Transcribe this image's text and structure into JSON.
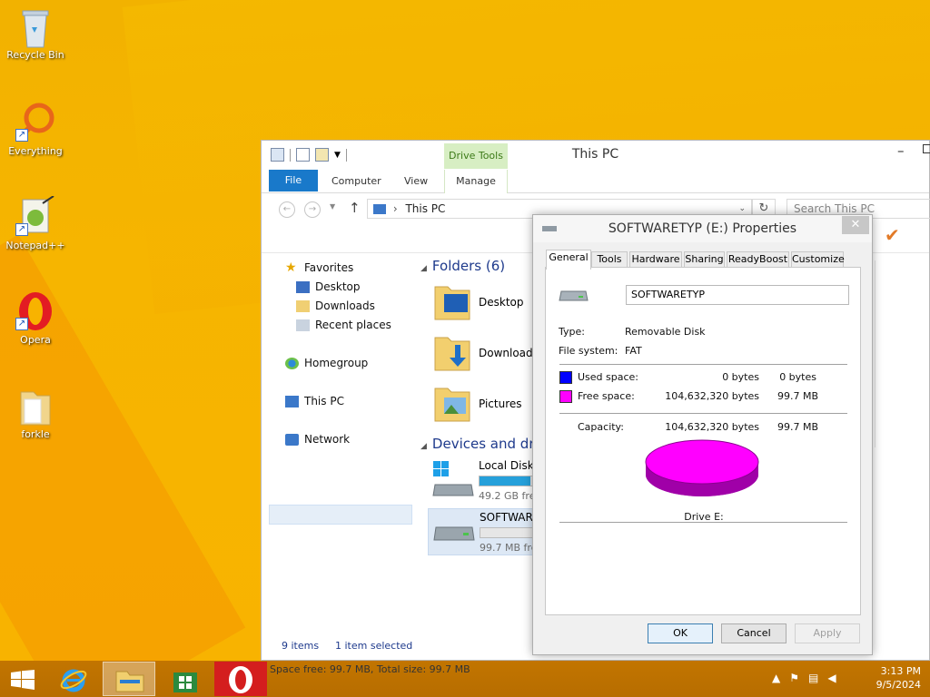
{
  "desktop": {
    "icons": [
      {
        "label": "Recycle Bin"
      },
      {
        "label": "Everything"
      },
      {
        "label": "Notepad++"
      },
      {
        "label": "Opera"
      },
      {
        "label": "forkle"
      }
    ]
  },
  "explorer": {
    "title": "This PC",
    "ribbon": {
      "contextual_group": "Drive Tools",
      "tabs": [
        "File",
        "Computer",
        "View",
        "Manage"
      ]
    },
    "address": "This PC",
    "search_placeholder": "Search This PC",
    "nav": {
      "favorites": "Favorites",
      "desktop": "Desktop",
      "downloads": "Downloads",
      "recent": "Recent places",
      "homegroup": "Homegroup",
      "thispc": "This PC",
      "network": "Network"
    },
    "folders_header": "Folders (6)",
    "folders": [
      "Desktop",
      "Downloads",
      "Pictures"
    ],
    "devices_header": "Devices and drives",
    "drives": [
      {
        "name": "Local Disk (",
        "free": "49.2 GB free",
        "used_fraction": 0.82
      },
      {
        "name": "SOFTWARE",
        "free": "99.7 MB free",
        "used_fraction": 0.0
      }
    ],
    "status": {
      "items": "9 items",
      "selected": "1 item selected"
    },
    "space_status": "Space free: 99.7 MB, Total size: 99.7 MB"
  },
  "dialog": {
    "title": "SOFTWARETYP (E:) Properties",
    "tabs": [
      "General",
      "Tools",
      "Hardware",
      "Sharing",
      "ReadyBoost",
      "Customize"
    ],
    "volume_name": "SOFTWARETYP",
    "type_label": "Type:",
    "type_value": "Removable Disk",
    "fs_label": "File system:",
    "fs_value": "FAT",
    "used_label": "Used space:",
    "used_bytes": "0 bytes",
    "used_short": "0 bytes",
    "free_label": "Free space:",
    "free_bytes": "104,632,320 bytes",
    "free_short": "99.7 MB",
    "capacity_label": "Capacity:",
    "capacity_bytes": "104,632,320 bytes",
    "capacity_short": "99.7 MB",
    "drive_label": "Drive E:",
    "colors": {
      "used": "#0000ff",
      "free": "#ff00ff"
    },
    "buttons": {
      "ok": "OK",
      "cancel": "Cancel",
      "apply": "Apply"
    }
  },
  "taskbar": {
    "time": "3:13 PM",
    "date": "9/5/2024"
  }
}
